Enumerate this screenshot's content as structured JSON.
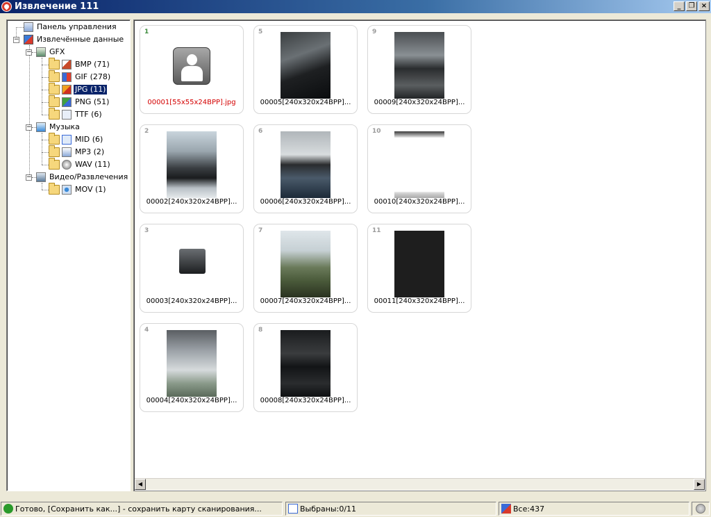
{
  "window": {
    "title": "Извлечение 111",
    "minimize": "_",
    "restore": "❐",
    "close": "×"
  },
  "tree": {
    "control_panel": "Панель управления",
    "extracted": "Извлечённые данные",
    "gfx": "GFX",
    "bmp": "BMP (71)",
    "gif": "GIF (278)",
    "jpg": "JPG (11)",
    "png": "PNG (51)",
    "ttf": "TTF (6)",
    "music": "Музыка",
    "mid": "MID (6)",
    "mp3": "MP3 (2)",
    "wav": "WAV (11)",
    "video": "Видео/Развлечения",
    "mov": "MOV (1)",
    "expander_open": "−",
    "selected": "JPG (11)"
  },
  "items": [
    {
      "num": "1",
      "caption": "00001[55x55x24BPP].jpg"
    },
    {
      "num": "2",
      "caption": "00002[240x320x24BPP]..."
    },
    {
      "num": "3",
      "caption": "00003[240x320x24BPP]..."
    },
    {
      "num": "4",
      "caption": "00004[240x320x24BPP]..."
    },
    {
      "num": "5",
      "caption": "00005[240x320x24BPP]..."
    },
    {
      "num": "6",
      "caption": "00006[240x320x24BPP]..."
    },
    {
      "num": "7",
      "caption": "00007[240x320x24BPP]..."
    },
    {
      "num": "8",
      "caption": "00008[240x320x24BPP]..."
    },
    {
      "num": "9",
      "caption": "00009[240x320x24BPP]..."
    },
    {
      "num": "10",
      "caption": "00010[240x320x24BPP]..."
    },
    {
      "num": "11",
      "caption": "00011[240x320x24BPP]..."
    }
  ],
  "scroll": {
    "left": "◀",
    "right": "▶"
  },
  "status": {
    "ready": "Готово, [Сохранить как...] - сохранить карту сканирования...",
    "selected": "Выбраны:0/11",
    "total": "Все:437"
  },
  "colors": {
    "selection": "#0a246a",
    "first_caption": "#d40000",
    "titlebar": "#0a246a"
  }
}
